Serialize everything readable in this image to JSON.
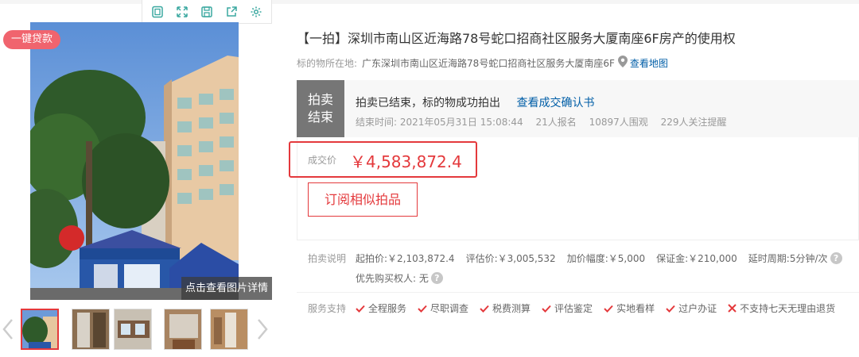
{
  "loan_badge": "一键贷款",
  "image_overlay": "点击查看图片详情",
  "toolbar": {
    "icons": [
      "photo-frame-icon",
      "fullscreen-icon",
      "save-icon",
      "share-icon",
      "settings-icon"
    ]
  },
  "title": "【一拍】深圳市南山区近海路78号蛇口招商社区服务大厦南座6F房产的使用权",
  "location": {
    "label": "标的物所在地:",
    "value": "广东深圳市南山区近海路78号蛇口招商社区服务大厦南座6F",
    "map_link": "查看地图"
  },
  "status": {
    "tag_line1": "拍卖",
    "tag_line2": "结束",
    "message": "拍卖已结束，标的物成功拍出",
    "link": "查看成交确认书",
    "end_time": "结束时间:   2021年05月31日 15:08:44",
    "registrations": "21人报名",
    "viewers": "10897人围观",
    "followers": "229人关注提醒"
  },
  "price": {
    "label": "成交价",
    "value": "￥4,583,872.4"
  },
  "subscribe_button": "订阅相似拍品",
  "auction_info": {
    "label": "拍卖说明",
    "start_price": "起拍价:￥2,103,872.4",
    "appraisal": "评估价:￥3,005,532",
    "increment": "加价幅度:￥5,000",
    "deposit": "保证金:￥210,000",
    "delay": "延时周期:5分钟/次",
    "priority": "优先购买权人: 无"
  },
  "services": {
    "label": "服务支持",
    "items": [
      "全程服务",
      "尽职调查",
      "税费测算",
      "评估鉴定",
      "实地看样",
      "过户办证"
    ],
    "no_return": "不支持七天无理由退货"
  },
  "colors": {
    "accent_red": "#e4393c",
    "link_blue": "#005ea7",
    "badge_pink": "#f0646e",
    "status_gray": "#767676"
  }
}
